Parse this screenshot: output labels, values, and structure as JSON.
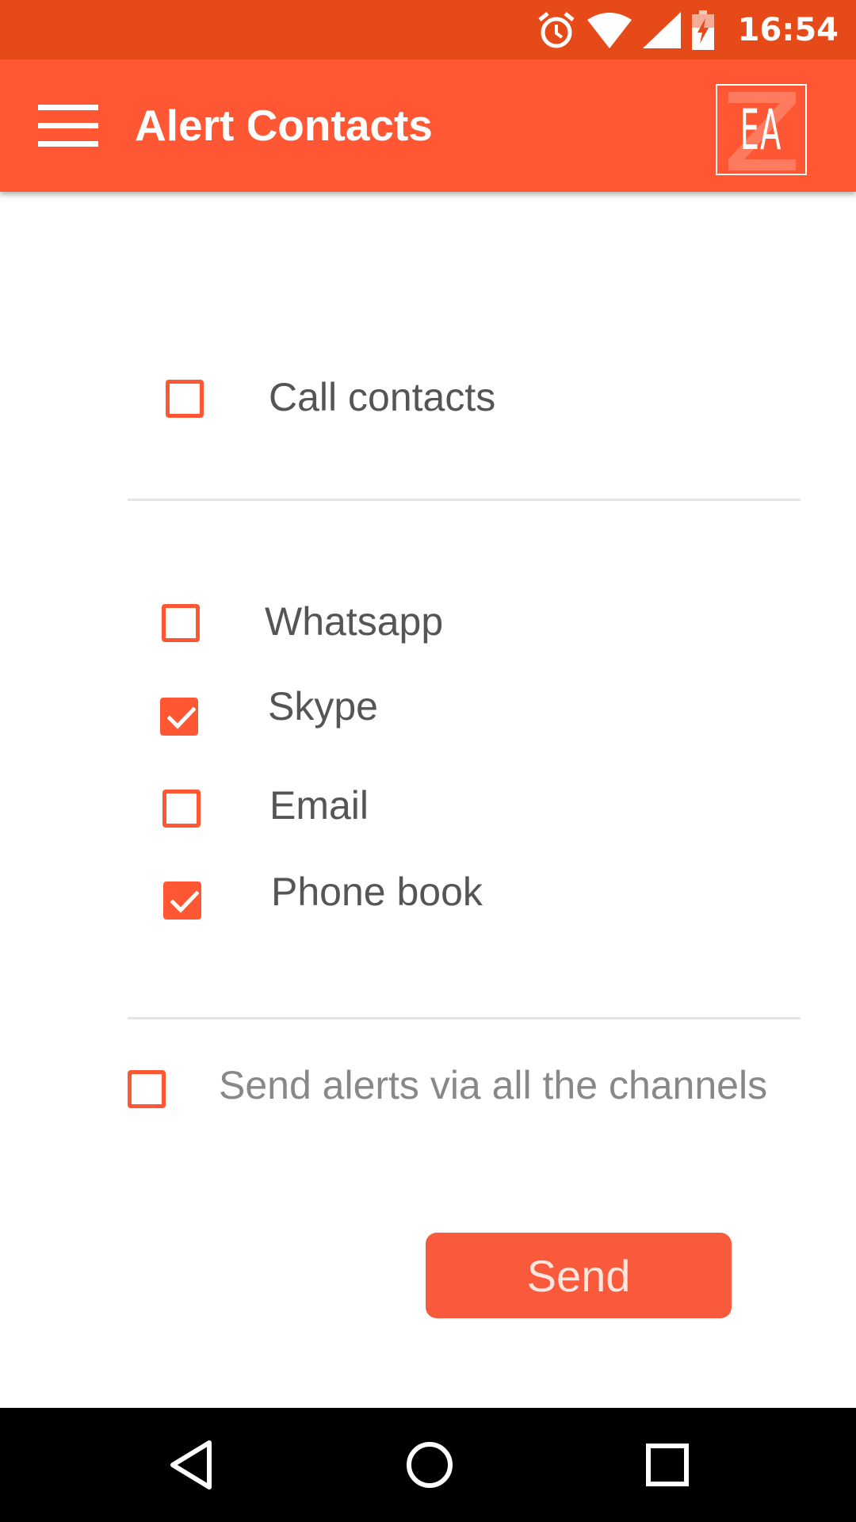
{
  "status_bar": {
    "time": "16:54",
    "icons": [
      "alarm-icon",
      "wifi-icon",
      "signal-icon",
      "battery-charging-icon"
    ]
  },
  "app_bar": {
    "title": "Alert Contacts",
    "menu_icon": "hamburger-menu-icon",
    "logo_text": "EA"
  },
  "options": {
    "call_contacts": {
      "label": "Call contacts",
      "checked": false
    },
    "channels": [
      {
        "label": "Whatsapp",
        "checked": false
      },
      {
        "label": "Skype",
        "checked": true
      },
      {
        "label": "Email",
        "checked": false
      },
      {
        "label": "Phone book",
        "checked": true
      }
    ],
    "all_channels": {
      "label": "Send alerts via all the channels",
      "checked": false
    }
  },
  "send_button": {
    "label": "Send"
  },
  "nav_bar": {
    "icons": [
      "back-icon",
      "home-icon",
      "recents-icon"
    ]
  },
  "colors": {
    "status_bar": "#E64A19",
    "app_bar": "#FF5733",
    "accent": "#FF5733",
    "button": "#FA5A3C",
    "text": "#555555"
  }
}
